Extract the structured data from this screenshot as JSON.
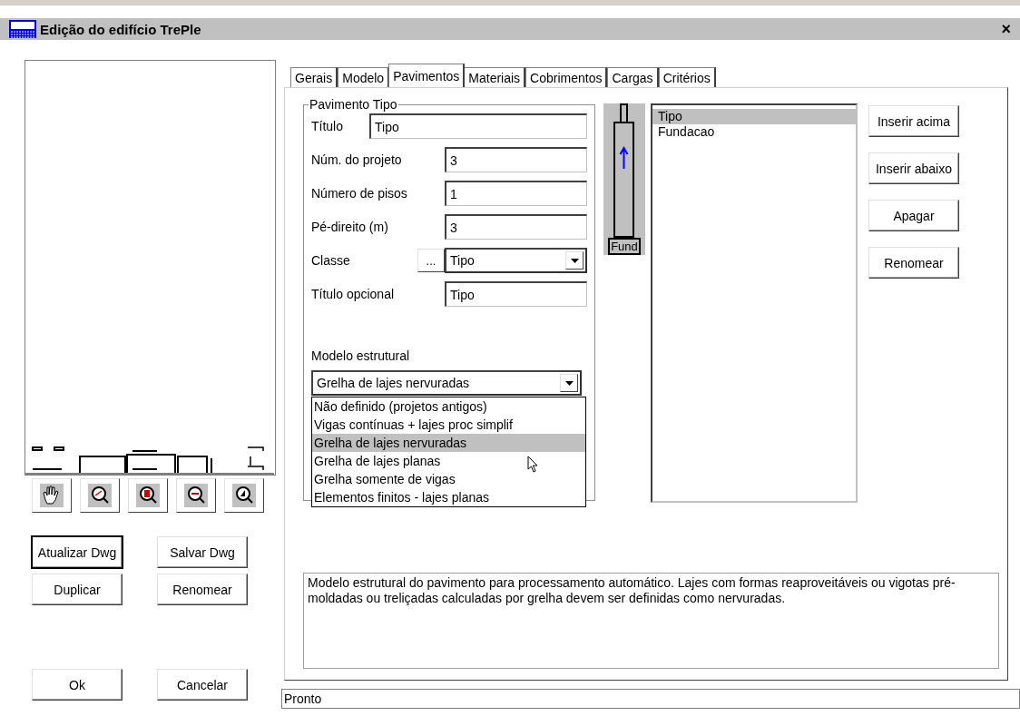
{
  "window": {
    "title": "Edição do edifício TrePle",
    "close": "×"
  },
  "left_buttons": [
    {
      "label": "Atualizar Dwg",
      "default": true
    },
    {
      "label": "Salvar Dwg",
      "default": false
    },
    {
      "label": "Duplicar",
      "default": false
    },
    {
      "label": "Renomear",
      "default": false
    }
  ],
  "dialog_buttons": [
    "Ok",
    "Cancelar"
  ],
  "tabs": [
    {
      "label": "Gerais",
      "selected": false
    },
    {
      "label": "Modelo",
      "selected": false
    },
    {
      "label": "Pavimentos",
      "selected": true
    },
    {
      "label": "Materiais",
      "selected": false
    },
    {
      "label": "Cobrimentos",
      "selected": false
    },
    {
      "label": "Cargas",
      "selected": false
    },
    {
      "label": "Critérios",
      "selected": false
    }
  ],
  "group": {
    "title": "Pavimento Tipo",
    "fields": [
      {
        "kind": "text",
        "label": "Título",
        "value": "Tipo"
      },
      {
        "kind": "text",
        "label": "Núm. do projeto",
        "value": "3"
      },
      {
        "kind": "text",
        "label": "Número de pisos",
        "value": "1"
      },
      {
        "kind": "text",
        "label": "Pé-direito (m)",
        "value": "3"
      },
      {
        "kind": "combo",
        "label": "Classe",
        "browse": "...",
        "value": "Tipo"
      },
      {
        "kind": "text",
        "label": "Título opcional",
        "value": "Tipo"
      }
    ],
    "model_label": "Modelo estrutural",
    "model_value": "Grelha de lajes nervuradas",
    "model_options": [
      {
        "label": "Não definido (projetos antigos)",
        "selected": false
      },
      {
        "label": "Vigas contínuas + lajes proc simplif",
        "selected": false
      },
      {
        "label": "Grelha de lajes nervuradas",
        "selected": true
      },
      {
        "label": "Grelha de lajes planas",
        "selected": false
      },
      {
        "label": "Grelha somente de vigas",
        "selected": false
      },
      {
        "label": "Elementos finitos - lajes planas",
        "selected": false
      }
    ]
  },
  "floor_diagram": {
    "base_label": "Fund"
  },
  "floors": [
    {
      "label": "Tipo",
      "selected": true
    },
    {
      "label": "Fundacao",
      "selected": false
    }
  ],
  "floor_buttons": [
    "Inserir acima",
    "Inserir abaixo",
    "Apagar",
    "Renomear"
  ],
  "description": "Modelo estrutural do pavimento para processamento automático. Lajes com formas reaproveitáveis ou vigotas pré-moldadas ou treliçadas calculadas por grelha devem ser definidas como nervuradas.",
  "status": "Pronto"
}
